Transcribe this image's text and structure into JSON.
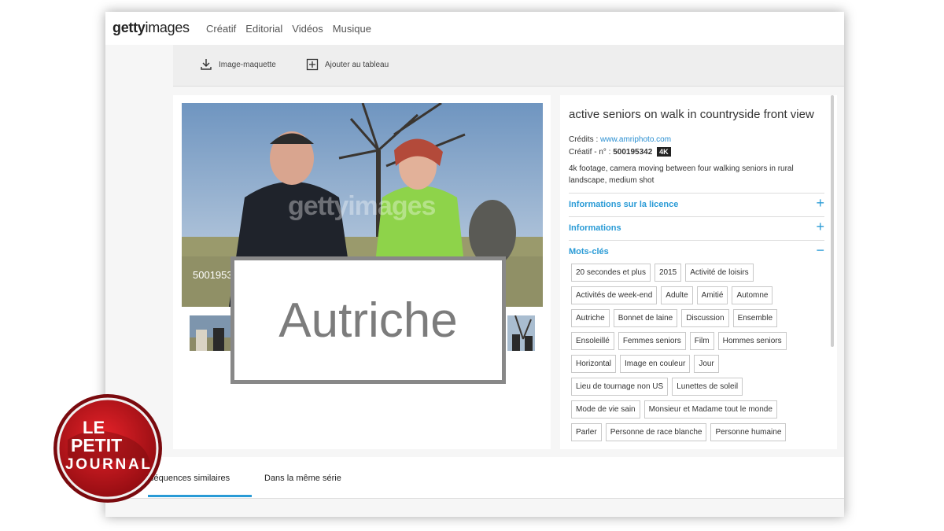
{
  "header": {
    "logo_bold": "getty",
    "logo_light": "images",
    "nav": [
      {
        "label": "Créatif"
      },
      {
        "label": "Editorial"
      },
      {
        "label": "Vidéos"
      },
      {
        "label": "Musique"
      }
    ]
  },
  "toolbar": {
    "download_label": "Image-maquette",
    "board_label": "Ajouter au tableau"
  },
  "video": {
    "watermark": "gettyimages",
    "id_partial": "5001953"
  },
  "overlay": {
    "text": "Autriche"
  },
  "details": {
    "title": "active seniors on walk in countryside front view",
    "credits_label": "Crédits :",
    "credits_link": "www.amriphoto.com",
    "creative_label": "Créatif - n° :",
    "creative_number": "500195342",
    "resolution_badge": "4K",
    "description": "4k footage, camera moving between four walking seniors in rural landscape, medium shot",
    "sections": [
      {
        "label": "Informations sur la licence",
        "sign": "+"
      },
      {
        "label": "Informations",
        "sign": "+"
      },
      {
        "label": "Mots-clés",
        "sign": "−"
      }
    ],
    "keyword_rows": [
      [
        "20 secondes et plus",
        "2015",
        "Activité de loisirs"
      ],
      [
        "Activités de week-end",
        "Adulte",
        "Amitié",
        "Automne"
      ],
      [
        "Autriche",
        "Bonnet de laine",
        "Discussion",
        "Ensemble"
      ],
      [
        "Ensoleillé",
        "Femmes seniors",
        "Film",
        "Hommes seniors"
      ],
      [
        "Horizontal",
        "Image en couleur",
        "Jour"
      ],
      [
        "Lieu de tournage non US",
        "Lunettes de soleil"
      ],
      [
        "Mode de vie sain",
        "Monsieur et Madame tout le monde"
      ],
      [
        "Parler",
        "Personne de race blanche",
        "Personne humaine"
      ]
    ]
  },
  "bottom_tabs": [
    {
      "label": "séquences similaires"
    },
    {
      "label": "Dans la même série"
    }
  ],
  "broadcast_logo": {
    "line1": "LE",
    "line2": "PETIT",
    "line3": "JOURNAL"
  },
  "colors": {
    "accent": "#2a9bd6",
    "logo_red": "#d5121b"
  }
}
